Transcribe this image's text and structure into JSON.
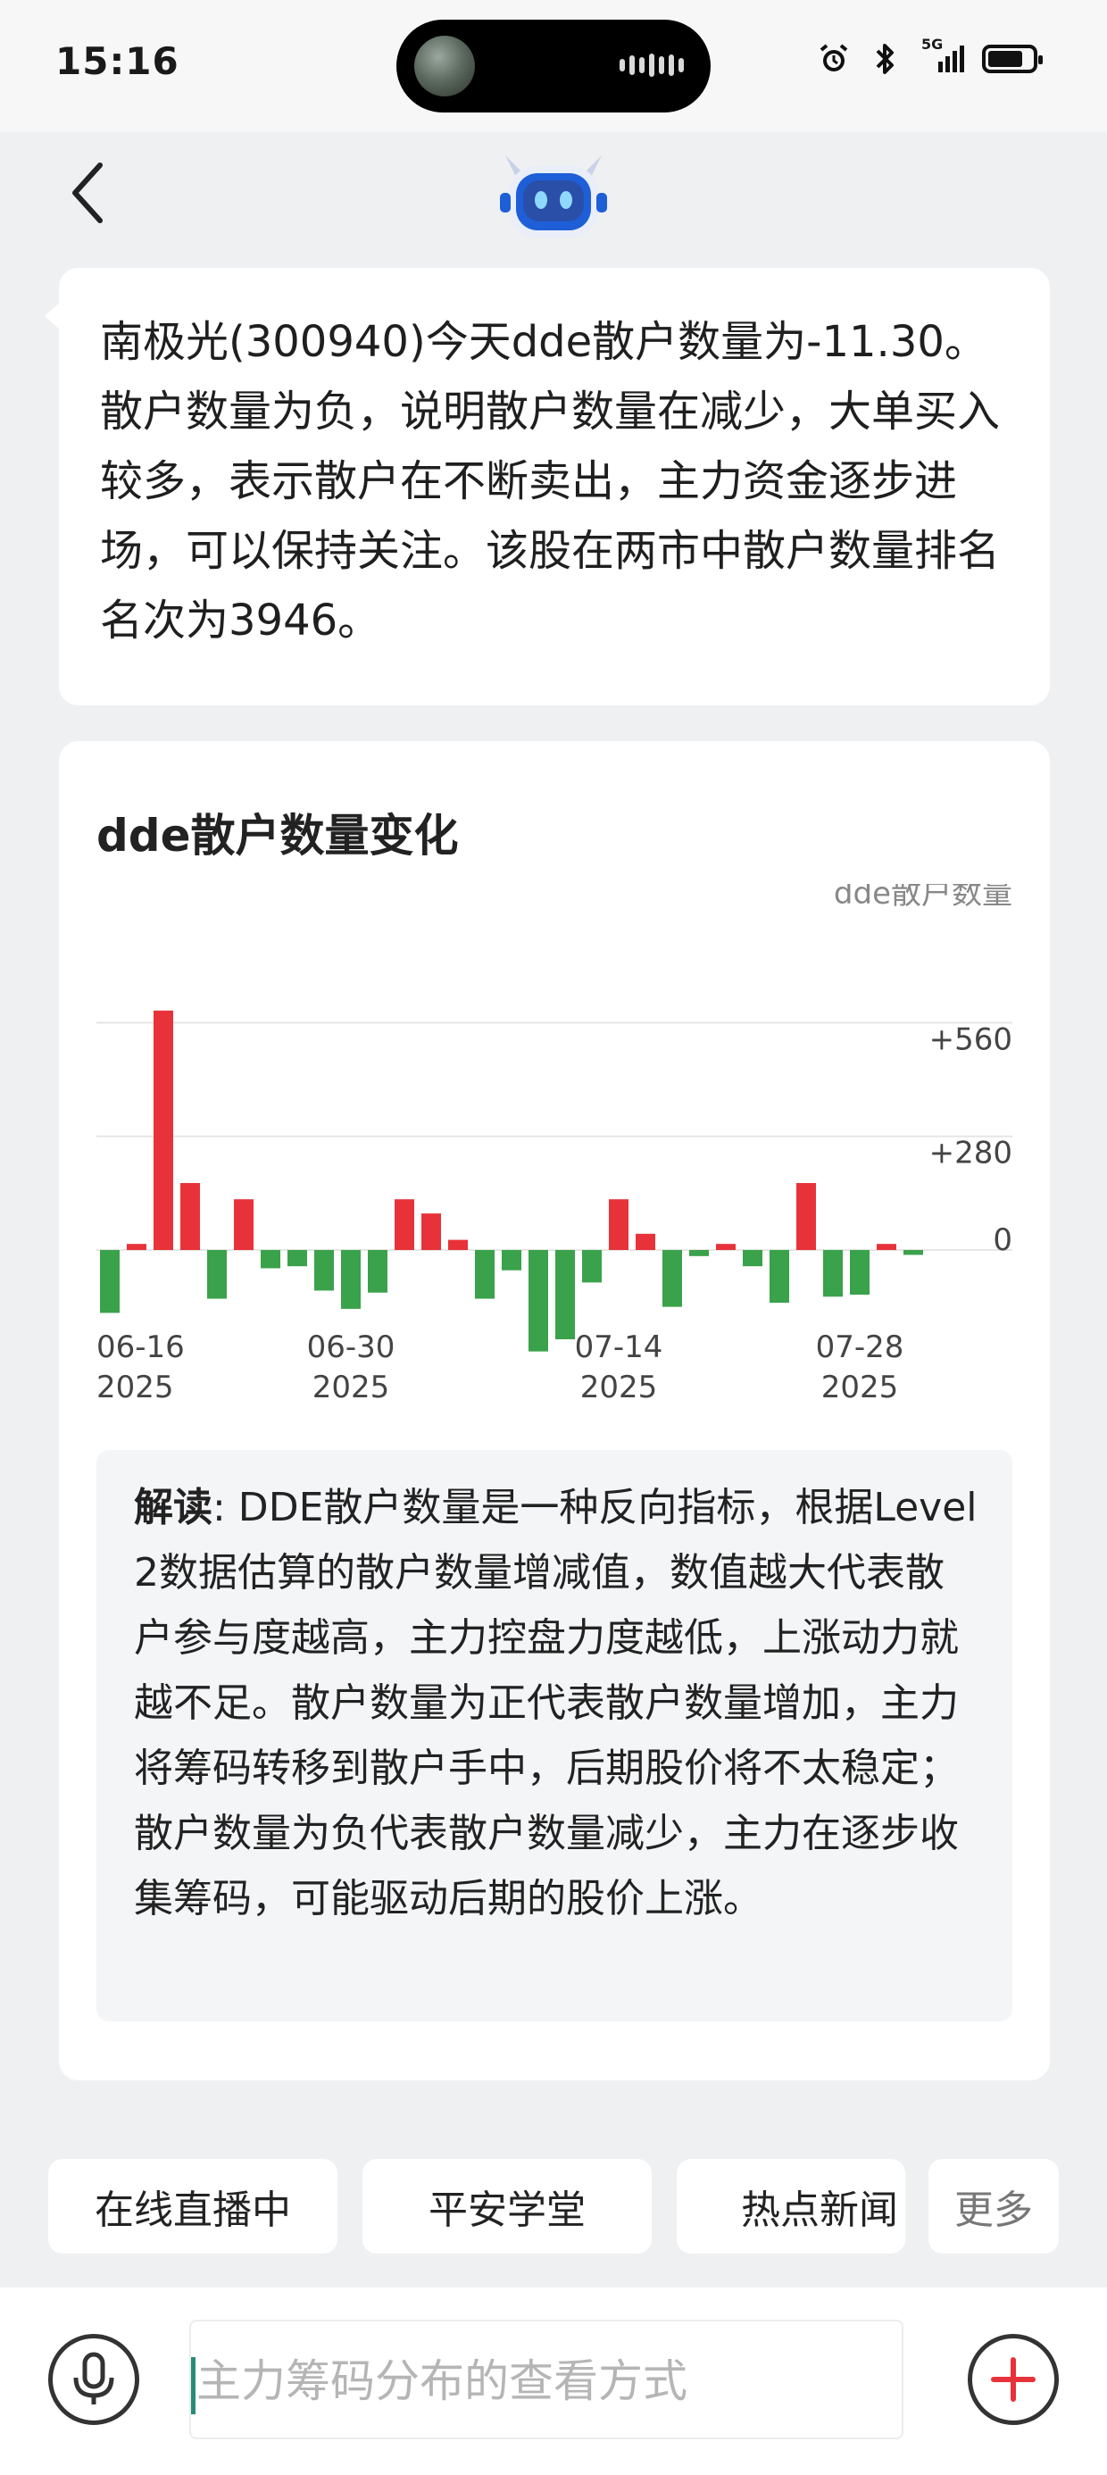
{
  "status_bar": {
    "time": "15:16",
    "network_label": "5G"
  },
  "nav": {
    "back_icon": "chevron-left-icon",
    "avatar_icon": "robot-icon"
  },
  "message": {
    "text": "南极光(300940)今天dde散户数量为-11.30。散户数量为负，说明散户数量在减少，大单买入较多，表示散户在不断卖出，主力资金逐步进场，可以保持关注。该股在两市中散户数量排名名次为3946。"
  },
  "chart_card": {
    "title": "dde散户数量变化",
    "explain_label": "解读",
    "explain_text": ": DDE散户数量是一种反向指标，根据Level2数据估算的散户数量增减值，数值越大代表散户参与度越高，主力控盘力度越低，上涨动力就越不足。散户数量为正代表散户数量增加，主力将筹码转移到散户手中，后期股价将不太稳定；散户数量为负代表散户数量减少，主力在逐步收集筹码，可能驱动后期的股价上涨。"
  },
  "chart_data": {
    "type": "bar",
    "title": "dde散户数量变化",
    "ylabel": "dde散户数量",
    "y_ticks": [
      "+560",
      "+280",
      "0"
    ],
    "y_tick_values": [
      560,
      280,
      0
    ],
    "ylim": [
      -260,
      600
    ],
    "x_tick_labels": [
      {
        "date": "06-16",
        "year": "2025"
      },
      {
        "date": "06-30",
        "year": "2025"
      },
      {
        "date": "07-14",
        "year": "2025"
      },
      {
        "date": "07-28",
        "year": "2025"
      }
    ],
    "x_tick_bar_index": [
      0,
      9,
      19,
      28
    ],
    "grid": true,
    "positive_color": "#e8323a",
    "negative_color": "#3aa24a",
    "values": [
      -155,
      15,
      590,
      165,
      -120,
      125,
      -45,
      -40,
      -100,
      -145,
      -105,
      125,
      90,
      25,
      -120,
      -50,
      -250,
      -220,
      -80,
      125,
      40,
      -140,
      -15,
      15,
      -40,
      -130,
      165,
      -115,
      -110,
      15,
      -12
    ]
  },
  "quick_actions": {
    "items": [
      "在线直播中",
      "平安学堂",
      "热点新闻"
    ],
    "more_label": "更多"
  },
  "input_bar": {
    "placeholder": "主力筹码分布的查看方式",
    "mic_icon": "microphone-icon",
    "plus_icon": "plus-icon",
    "plus_color": "#e8323a"
  }
}
